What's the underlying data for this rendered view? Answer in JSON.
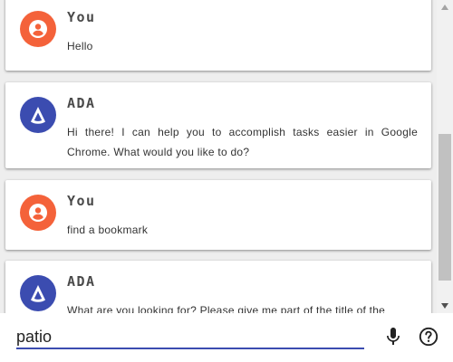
{
  "messages": [
    {
      "sender": "You",
      "role": "user",
      "text": "Hello"
    },
    {
      "sender": "ADA",
      "role": "assistant",
      "text": "Hi there! I can help you to accomplish tasks easier in Google Chrome. What would you like to do?"
    },
    {
      "sender": "You",
      "role": "user",
      "text": "find a bookmark"
    },
    {
      "sender": "ADA",
      "role": "assistant",
      "text": "What are you looking for? Please give me part of the title of the"
    }
  ],
  "input": {
    "value": "patio"
  },
  "icons": {
    "user_avatar": "person-circle-icon",
    "ada_avatar": "ada-logo-icon",
    "mic": "microphone-icon",
    "help": "help-circle-icon"
  },
  "colors": {
    "user_avatar": "#f4623a",
    "ada_avatar": "#3b4cb0",
    "input_underline": "#3b4cb0"
  }
}
